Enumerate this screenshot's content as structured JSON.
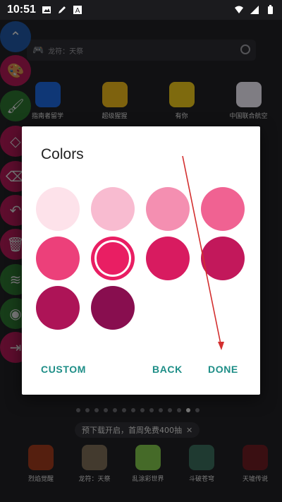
{
  "status_bar": {
    "time": "10:51"
  },
  "launcher": {
    "search_placeholder": "龙符：天祭",
    "top_apps": [
      {
        "label": "指南者留学",
        "color": "#1d64d8"
      },
      {
        "label": "超级猩猩",
        "color": "#e6b31a"
      },
      {
        "label": "有你",
        "color": "#e5c21a"
      },
      {
        "label": "中国联合航空",
        "color": "#e8e4ee"
      }
    ],
    "promo_text": "预下载开启，首周免费400抽",
    "dock_apps": [
      {
        "label": "烈焰觉醒",
        "color": "#9b3a1c"
      },
      {
        "label": "龙符：天祭",
        "color": "#7a6a55"
      },
      {
        "label": "乱涂彩世界",
        "color": "#7ec24a"
      },
      {
        "label": "斗破苍穹",
        "color": "#3a6a5a"
      },
      {
        "label": "天墟传说",
        "color": "#6a1c22"
      }
    ]
  },
  "tool_strip": {
    "items": [
      {
        "name": "collapse-icon",
        "glyph": "⌃",
        "color": "#1f5fb5"
      },
      {
        "name": "palette-icon",
        "glyph": "🎨",
        "color": "#c2185b"
      },
      {
        "name": "brush-icon",
        "glyph": "🖌",
        "color": "#2e7d32"
      },
      {
        "name": "shapes-icon",
        "glyph": "◇",
        "color": "#c2185b"
      },
      {
        "name": "eraser-icon",
        "glyph": "⌫",
        "color": "#c2185b"
      },
      {
        "name": "undo-icon",
        "glyph": "↶",
        "color": "#c2185b"
      },
      {
        "name": "delete-icon",
        "glyph": "🗑",
        "color": "#c2185b"
      },
      {
        "name": "layers-icon",
        "glyph": "≋",
        "color": "#2e7d32"
      },
      {
        "name": "hide-icon",
        "glyph": "◉",
        "color": "#2e7d32"
      },
      {
        "name": "exit-icon",
        "glyph": "⇥",
        "color": "#c2185b"
      }
    ]
  },
  "dialog": {
    "title": "Colors",
    "swatches": [
      "#fde2ea",
      "#f8bbd0",
      "#f48fb1",
      "#f06292",
      "#ec407a",
      "#e91e63",
      "#d81b60",
      "#c2185b",
      "#ad1457",
      "#880e4f"
    ],
    "selected_index": 5,
    "buttons": {
      "custom": "CUSTOM",
      "back": "BACK",
      "done": "DONE"
    },
    "accent_color": "#1e8e87"
  }
}
